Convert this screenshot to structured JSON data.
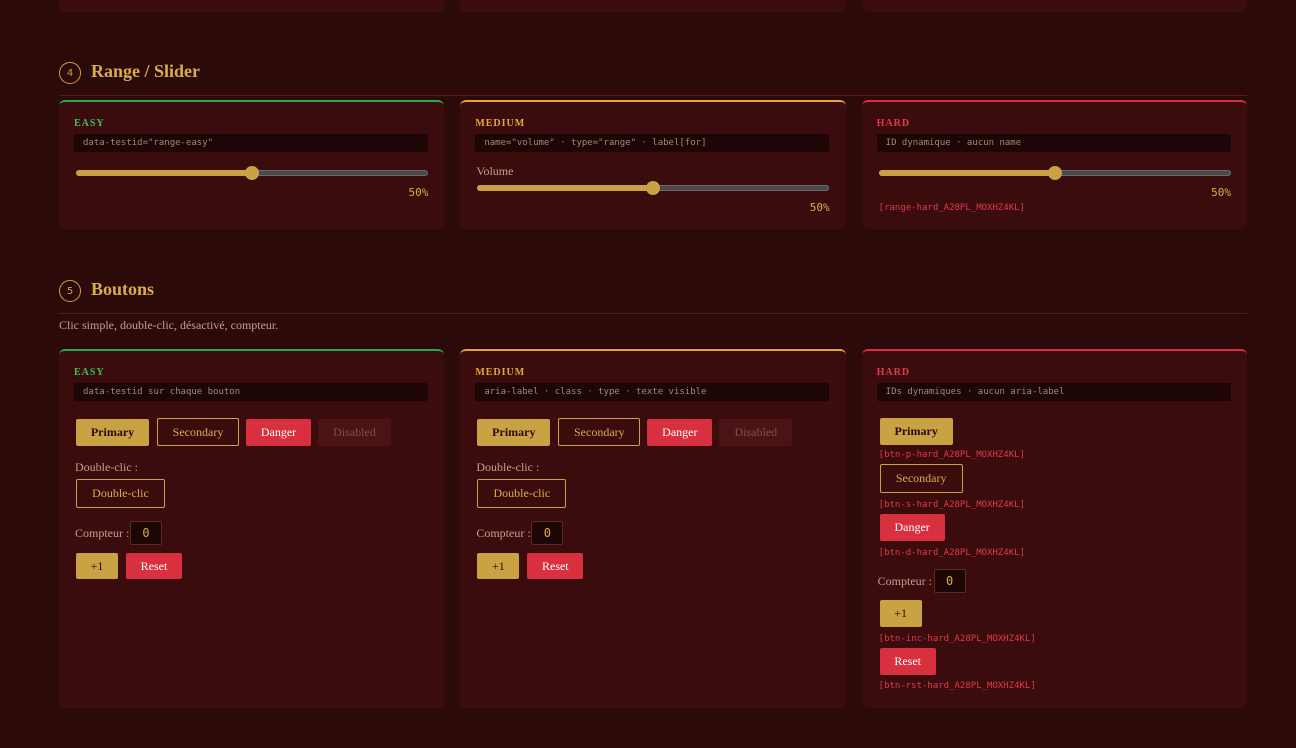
{
  "sections": {
    "range": {
      "num": "4",
      "title": "Range / Slider"
    },
    "buttons": {
      "num": "5",
      "title": "Boutons",
      "desc": "Clic simple, double-clic, désactivé, compteur."
    }
  },
  "range": {
    "easy": {
      "level": "EASY",
      "code": "data-testid=\"range-easy\"",
      "value": 50,
      "pct": "50%"
    },
    "medium": {
      "level": "MEDIUM",
      "code": "name=\"volume\" · type=\"range\" · label[for]",
      "label": "Volume",
      "value": 50,
      "pct": "50%"
    },
    "hard": {
      "level": "HARD",
      "code": "ID dynamique · aucun name",
      "value": 50,
      "pct": "50%",
      "dyn_id": "[range-hard_A28PL_MOXHZ4KL]"
    }
  },
  "buttons": {
    "easy": {
      "level": "EASY",
      "code": "data-testid sur chaque bouton",
      "primary": "Primary",
      "secondary": "Secondary",
      "danger": "Danger",
      "disabled": "Disabled",
      "dbl_label": "Double-clic :",
      "dbl": "Double-clic",
      "counter_label": "Compteur :",
      "counter": "0",
      "inc": "+1",
      "reset": "Reset"
    },
    "medium": {
      "level": "MEDIUM",
      "code": "aria-label · class · type · texte visible",
      "primary": "Primary",
      "secondary": "Secondary",
      "danger": "Danger",
      "disabled": "Disabled",
      "dbl_label": "Double-clic :",
      "dbl": "Double-clic",
      "counter_label": "Compteur :",
      "counter": "0",
      "inc": "+1",
      "reset": "Reset"
    },
    "hard": {
      "level": "HARD",
      "code": "IDs dynamiques · aucun aria-label",
      "primary": "Primary",
      "primary_id": "[btn-p-hard_A28PL_MOXHZ4KL]",
      "secondary": "Secondary",
      "secondary_id": "[btn-s-hard_A28PL_MOXHZ4KL]",
      "danger": "Danger",
      "danger_id": "[btn-d-hard_A28PL_MOXHZ4KL]",
      "counter_label": "Compteur :",
      "counter": "0",
      "inc": "+1",
      "inc_id": "[btn-inc-hard_A28PL_MOXHZ4KL]",
      "reset": "Reset",
      "reset_id": "[btn-rst-hard_A28PL_MOXHZ4KL]"
    }
  },
  "colors": {
    "bg": "#2d0a0a",
    "card": "#3b0c0d",
    "accent": "#c9a244",
    "easy": "#3cc05a",
    "medium": "#e6a83a",
    "hard": "#e23a48",
    "danger": "#d8303f"
  }
}
